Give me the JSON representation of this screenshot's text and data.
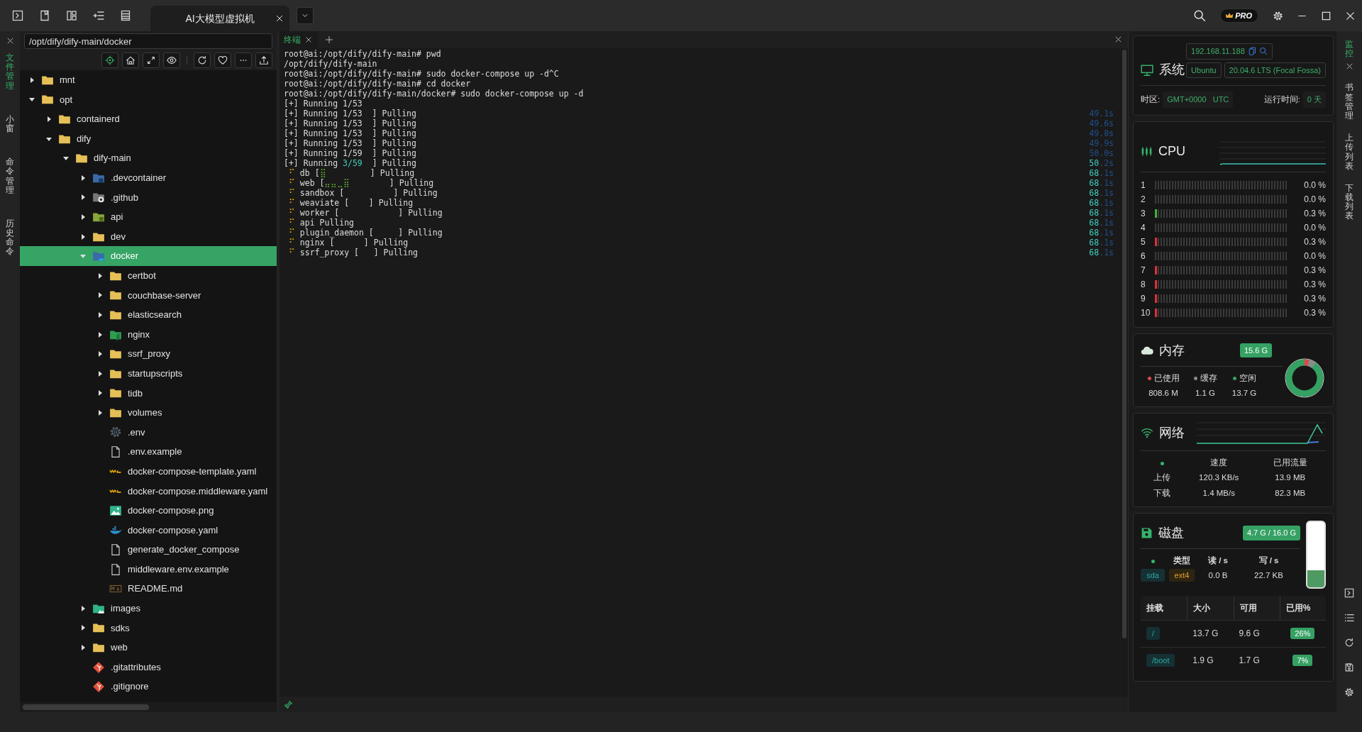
{
  "window": {
    "tab": {
      "label": "AI大模型虚拟机",
      "selected": true
    },
    "pro_badge": "PRO"
  },
  "left_tabs": [
    {
      "label": "文件管理",
      "selected": true
    },
    {
      "label": "小窗",
      "selected": false
    },
    {
      "label": "命令管理",
      "selected": false
    },
    {
      "label": "历史命令",
      "selected": false
    }
  ],
  "file_panel": {
    "path": "/opt/dify/dify-main/docker",
    "tree": [
      {
        "name": "mnt",
        "kind": "folder",
        "selected": false,
        "expanded": false
      },
      {
        "name": "opt",
        "kind": "folder",
        "selected": false,
        "expanded": true,
        "children": [
          {
            "name": "containerd",
            "kind": "folder",
            "selected": false,
            "expanded": false
          },
          {
            "name": "dify",
            "kind": "folder",
            "selected": false,
            "expanded": true,
            "children": [
              {
                "name": "dify-main",
                "kind": "folder",
                "selected": false,
                "expanded": true,
                "children": [
                  {
                    "name": ".devcontainer",
                    "kind": "vscode-folder",
                    "selected": false,
                    "expanded": false
                  },
                  {
                    "name": ".github",
                    "kind": "github-folder",
                    "selected": false,
                    "expanded": false
                  },
                  {
                    "name": "api",
                    "kind": "api-folder",
                    "selected": false,
                    "expanded": false
                  },
                  {
                    "name": "dev",
                    "kind": "folder",
                    "selected": false,
                    "expanded": false
                  },
                  {
                    "name": "docker",
                    "kind": "docker-folder",
                    "selected": true,
                    "expanded": true,
                    "children": [
                      {
                        "name": "certbot",
                        "kind": "folder",
                        "selected": false,
                        "expanded": false
                      },
                      {
                        "name": "couchbase-server",
                        "kind": "folder",
                        "selected": false,
                        "expanded": false
                      },
                      {
                        "name": "elasticsearch",
                        "kind": "folder",
                        "selected": false,
                        "expanded": false
                      },
                      {
                        "name": "nginx",
                        "kind": "nginx-folder",
                        "selected": false,
                        "expanded": false
                      },
                      {
                        "name": "ssrf_proxy",
                        "kind": "folder",
                        "selected": false,
                        "expanded": false
                      },
                      {
                        "name": "startupscripts",
                        "kind": "folder",
                        "selected": false,
                        "expanded": false
                      },
                      {
                        "name": "tidb",
                        "kind": "folder",
                        "selected": false,
                        "expanded": false
                      },
                      {
                        "name": "volumes",
                        "kind": "folder",
                        "selected": false,
                        "expanded": false
                      },
                      {
                        "name": ".env",
                        "kind": "gear",
                        "selected": false
                      },
                      {
                        "name": ".env.example",
                        "kind": "file",
                        "selected": false
                      },
                      {
                        "name": "docker-compose-template.yaml",
                        "kind": "yaml",
                        "selected": false
                      },
                      {
                        "name": "docker-compose.middleware.yaml",
                        "kind": "yaml",
                        "selected": false
                      },
                      {
                        "name": "docker-compose.png",
                        "kind": "image",
                        "selected": false
                      },
                      {
                        "name": "docker-compose.yaml",
                        "kind": "whale",
                        "selected": false
                      },
                      {
                        "name": "generate_docker_compose",
                        "kind": "file",
                        "selected": false
                      },
                      {
                        "name": "middleware.env.example",
                        "kind": "file",
                        "selected": false
                      },
                      {
                        "name": "README.md",
                        "kind": "markdown",
                        "selected": false
                      }
                    ]
                  },
                  {
                    "name": "images",
                    "kind": "images-folder",
                    "selected": false,
                    "expanded": false
                  },
                  {
                    "name": "sdks",
                    "kind": "folder",
                    "selected": false,
                    "expanded": false
                  },
                  {
                    "name": "web",
                    "kind": "folder",
                    "selected": false,
                    "expanded": false
                  },
                  {
                    "name": ".gitattributes",
                    "kind": "git",
                    "selected": false
                  },
                  {
                    "name": ".gitignore",
                    "kind": "git",
                    "selected": false
                  }
                ]
              }
            ]
          }
        ]
      }
    ]
  },
  "terminal": {
    "tabs": [
      {
        "label": "终端",
        "selected": true
      }
    ],
    "lines": [
      {
        "segs": [
          {
            "t": "root@ai:/opt/dify/dify-main# pwd",
            "kind": "plain"
          }
        ]
      },
      {
        "segs": [
          {
            "t": "/opt/dify/dify-main",
            "kind": "plain"
          }
        ]
      },
      {
        "segs": [
          {
            "t": "root@ai:/opt/dify/dify-main# sudo docker-compose up -d^C",
            "kind": "plain"
          }
        ]
      },
      {
        "segs": [
          {
            "t": "root@ai:/opt/dify/dify-main# cd docker",
            "kind": "plain"
          }
        ]
      },
      {
        "segs": [
          {
            "t": "root@ai:/opt/dify/dify-main/docker# sudo docker-compose up -d",
            "kind": "plain"
          }
        ]
      },
      {
        "segs": [
          {
            "t": "[+] Running 1/53",
            "kind": "plain"
          }
        ]
      },
      {
        "segs": [
          {
            "t": "[+] Running 1/53  ] Pulling",
            "kind": "plain"
          }
        ],
        "time": [
          {
            "t": "49.1s",
            "kind": "dim"
          }
        ]
      },
      {
        "segs": [
          {
            "t": "[+] Running 1/53  ] Pulling",
            "kind": "plain"
          }
        ],
        "time": [
          {
            "t": "49.6s",
            "kind": "dim"
          }
        ]
      },
      {
        "segs": [
          {
            "t": "[+] Running 1/53  ] Pulling",
            "kind": "plain"
          }
        ],
        "time": [
          {
            "t": "49.8s",
            "kind": "dim"
          }
        ]
      },
      {
        "segs": [
          {
            "t": "[+] Running 1/53  ] Pulling",
            "kind": "plain"
          }
        ],
        "time": [
          {
            "t": "49.9s",
            "kind": "dim"
          }
        ]
      },
      {
        "segs": [
          {
            "t": "[+] Running 1/59  ] Pulling",
            "kind": "plain"
          }
        ],
        "time": [
          {
            "t": "50.0s",
            "kind": "dim"
          }
        ]
      },
      {
        "segs": [
          {
            "t": "[+] Running ",
            "kind": "plain"
          },
          {
            "t": "3/59",
            "kind": "cyan"
          },
          {
            "t": "  ] Pulling",
            "kind": "plain"
          }
        ],
        "time": [
          {
            "t": "50",
            "kind": "cyan"
          },
          {
            "t": ".2s",
            "kind": "dim"
          }
        ]
      },
      {
        "segs": [
          {
            "t": " ⠋",
            "kind": "yellow"
          },
          {
            "t": " db [",
            "kind": "plain"
          },
          {
            "t": "⣿",
            "kind": "green"
          },
          {
            "t": "         ] Pulling",
            "kind": "plain"
          }
        ],
        "time": [
          {
            "t": "68",
            "kind": "cyan"
          },
          {
            "t": ".1s",
            "kind": "dim"
          }
        ]
      },
      {
        "segs": [
          {
            "t": " ⠋",
            "kind": "yellow"
          },
          {
            "t": " web [",
            "kind": "plain"
          },
          {
            "t": "⣤⣤⣀⣿",
            "kind": "green"
          },
          {
            "t": "        ] Pulling",
            "kind": "plain"
          }
        ],
        "time": [
          {
            "t": "68",
            "kind": "cyan"
          },
          {
            "t": ".1s",
            "kind": "dim"
          }
        ]
      },
      {
        "segs": [
          {
            "t": " ⠋",
            "kind": "yellow"
          },
          {
            "t": " sandbox [          ] Pulling",
            "kind": "plain"
          }
        ],
        "time": [
          {
            "t": "68",
            "kind": "cyan"
          },
          {
            "t": ".1s",
            "kind": "dim"
          }
        ]
      },
      {
        "segs": [
          {
            "t": " ⠋",
            "kind": "yellow"
          },
          {
            "t": " weaviate [    ] Pulling",
            "kind": "plain"
          }
        ],
        "time": [
          {
            "t": "68",
            "kind": "cyan"
          },
          {
            "t": ".1s",
            "kind": "dim"
          }
        ]
      },
      {
        "segs": [
          {
            "t": " ⠋",
            "kind": "yellow"
          },
          {
            "t": " worker [            ] Pulling",
            "kind": "plain"
          }
        ],
        "time": [
          {
            "t": "68",
            "kind": "cyan"
          },
          {
            "t": ".1s",
            "kind": "dim"
          }
        ]
      },
      {
        "segs": [
          {
            "t": " ⠋",
            "kind": "yellow"
          },
          {
            "t": " api Pulling",
            "kind": "plain"
          }
        ],
        "time": [
          {
            "t": "68",
            "kind": "cyan"
          },
          {
            "t": ".1s",
            "kind": "dim"
          }
        ]
      },
      {
        "segs": [
          {
            "t": " ⠋",
            "kind": "yellow"
          },
          {
            "t": " plugin_daemon [     ] Pulling",
            "kind": "plain"
          }
        ],
        "time": [
          {
            "t": "68",
            "kind": "cyan"
          },
          {
            "t": ".1s",
            "kind": "dim"
          }
        ]
      },
      {
        "segs": [
          {
            "t": " ⠋",
            "kind": "yellow"
          },
          {
            "t": " nginx [      ] Pulling",
            "kind": "plain"
          }
        ],
        "time": [
          {
            "t": "68",
            "kind": "cyan"
          },
          {
            "t": ".1s",
            "kind": "dim"
          }
        ]
      },
      {
        "segs": [
          {
            "t": " ⠋",
            "kind": "yellow"
          },
          {
            "t": " ssrf_proxy [   ] Pulling",
            "kind": "plain"
          }
        ],
        "time": [
          {
            "t": "68",
            "kind": "cyan"
          },
          {
            "t": ".1s",
            "kind": "dim"
          }
        ]
      }
    ]
  },
  "monitor": {
    "system": {
      "title": "系统",
      "ip": "192.168.11.188",
      "os": "Ubuntu",
      "version": "20.04.6 LTS (Focal Fossa)",
      "timezone_label": "时区:",
      "timezone": "GMT+0000   UTC",
      "uptime_label": "运行时间:",
      "uptime": "0 天"
    },
    "cpu": {
      "title": "CPU",
      "cores": [
        {
          "label": "1",
          "reading": "0.0 %"
        },
        {
          "label": "2",
          "reading": "0.0 %"
        },
        {
          "label": "3",
          "level": 0.003,
          "reading": "0.3 %",
          "color": "#3fb23f"
        },
        {
          "label": "4",
          "reading": "0.0 %"
        },
        {
          "label": "5",
          "level": 0.003,
          "reading": "0.3 %",
          "color": "#e0303a"
        },
        {
          "label": "6",
          "reading": "0.0 %"
        },
        {
          "label": "7",
          "level": 0.003,
          "reading": "0.3 %",
          "color": "#e0303a"
        },
        {
          "label": "8",
          "level": 0.003,
          "reading": "0.3 %",
          "color": "#e0303a"
        },
        {
          "label": "9",
          "level": 0.003,
          "reading": "0.3 %",
          "color": "#e0303a"
        },
        {
          "label": "10",
          "level": 0.003,
          "reading": "0.3 %",
          "color": "#e0303a"
        }
      ]
    },
    "memory": {
      "title": "内存",
      "total": "15.6 G",
      "legend": [
        {
          "label": "已使用",
          "value": "808.6 M",
          "color": "#e04848"
        },
        {
          "label": "缓存",
          "value": "1.1 G",
          "color": "#8a8a8a"
        },
        {
          "label": "空闲",
          "value": "13.7 G",
          "color": "#35a163"
        }
      ]
    },
    "network": {
      "title": "网络",
      "columns": [
        "速度",
        "已用流量"
      ],
      "rows": [
        {
          "label": "上传",
          "speed": "120.3 KB/s",
          "used": "13.9 MB"
        },
        {
          "label": "下载",
          "speed": "1.4 MB/s",
          "used": "82.3 MB"
        }
      ]
    },
    "disk": {
      "title": "磁盘",
      "usage": "4.7 G / 16.0 G",
      "level": 0.26,
      "columns": [
        "类型",
        "读 / s",
        "写 / s"
      ],
      "device": "sda",
      "fs": "ext4",
      "read": "0.0 B",
      "write": "22.7 KB",
      "mount_columns": [
        "挂载",
        "大小",
        "可用",
        "已用%"
      ],
      "mounts": [
        {
          "mount": "/",
          "size": "13.7 G",
          "avail": "9.6 G",
          "used": "26%"
        },
        {
          "mount": "/boot",
          "size": "1.9 G",
          "avail": "1.7 G",
          "used": "7%"
        }
      ]
    }
  },
  "right_tabs": [
    {
      "label": "监控",
      "selected": true
    },
    {
      "label": "书签管理",
      "selected": false
    },
    {
      "label": "上传列表",
      "selected": false
    },
    {
      "label": "下载列表",
      "selected": false
    }
  ]
}
